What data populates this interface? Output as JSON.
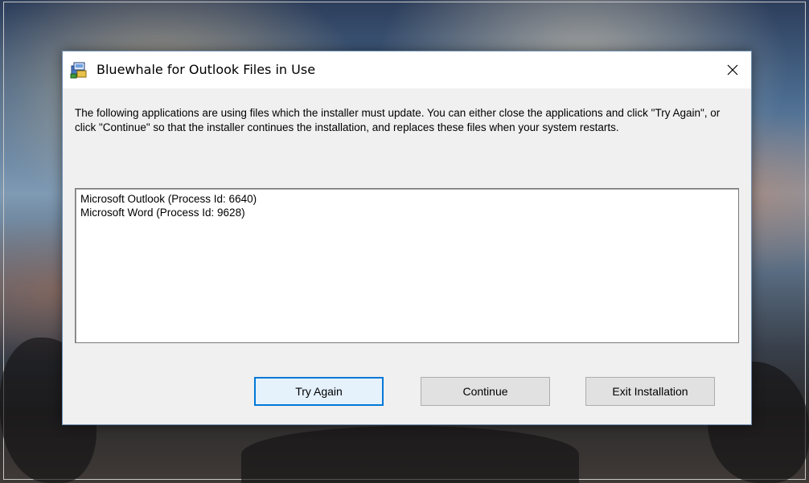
{
  "dialog": {
    "title": "Bluewhale for Outlook Files in Use",
    "app_icon": "installer-icon",
    "close_icon": "close-icon",
    "message": "The following applications are using files which the installer must update. You can either close the applications and click \"Try Again\", or click \"Continue\" so that the installer continues the installation, and replaces these files when your system restarts.",
    "processes": [
      "Microsoft Outlook (Process Id: 6640)",
      "Microsoft Word (Process Id: 9628)"
    ],
    "buttons": {
      "try_again": "Try Again",
      "continue": "Continue",
      "exit": "Exit Installation"
    },
    "colors": {
      "focus_border": "#0078d7",
      "dialog_background": "#f0f0f0"
    }
  }
}
